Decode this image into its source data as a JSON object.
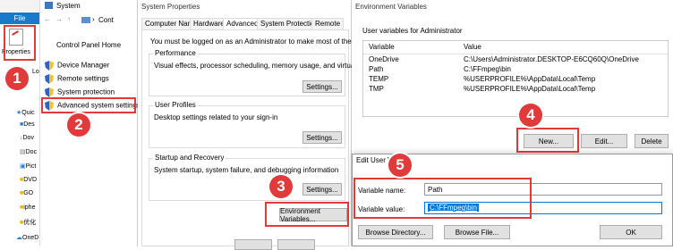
{
  "explorer": {
    "file_tab": "File",
    "properties_label": "Properties",
    "lo_label": "Lo",
    "nav_items": [
      "Quic",
      "Des",
      "Dov",
      "Doc",
      "Pict",
      "DVD",
      "GO",
      "iphe",
      "优化",
      "OneD"
    ]
  },
  "system": {
    "title": "System",
    "address": "Cont",
    "control_panel_home": "Control Panel Home",
    "links": [
      "Device Manager",
      "Remote settings",
      "System protection",
      "Advanced system settings"
    ]
  },
  "props": {
    "title": "System Properties",
    "tabs": [
      "Computer Name",
      "Hardware",
      "Advanced",
      "System Protection",
      "Remote"
    ],
    "logged_msg": "You must be logged on as an Administrator to make most of these changes.",
    "performance_title": "Performance",
    "performance_desc": "Visual effects, processor scheduling, memory usage, and virtual memory",
    "profiles_title": "User Profiles",
    "profiles_desc": "Desktop settings related to your sign-in",
    "startup_title": "Startup and Recovery",
    "startup_desc": "System startup, system failure, and debugging information",
    "settings_btn": "Settings...",
    "env_btn": "Environment Variables..."
  },
  "env": {
    "title": "Environment Variables",
    "user_vars_label": "User variables for Administrator",
    "col_variable": "Variable",
    "col_value": "Value",
    "rows": [
      {
        "var": "OneDrive",
        "val": "C:\\Users\\Administrator.DESKTOP-E6CQ60Q\\OneDrive"
      },
      {
        "var": "Path",
        "val": "C:\\FFmpeg\\bin"
      },
      {
        "var": "TEMP",
        "val": "%USERPROFILE%\\AppData\\Local\\Temp"
      },
      {
        "var": "TMP",
        "val": "%USERPROFILE%\\AppData\\Local\\Temp"
      }
    ],
    "new_btn": "New...",
    "edit_btn": "Edit...",
    "delete_btn": "Delete"
  },
  "edit": {
    "title": "Edit User V",
    "name_label": "Variable name:",
    "name_value": "Path",
    "value_label": "Variable value:",
    "value_value": "C:\\FFmpeg\\bin",
    "browse_dir_btn": "Browse Directory...",
    "browse_file_btn": "Browse File...",
    "ok_btn": "OK"
  },
  "badges": [
    "1",
    "2",
    "3",
    "4",
    "5"
  ],
  "colors": {
    "accent_red": "#e03a3a",
    "selection": "#0078d7",
    "file_blue": "#1979ca"
  }
}
